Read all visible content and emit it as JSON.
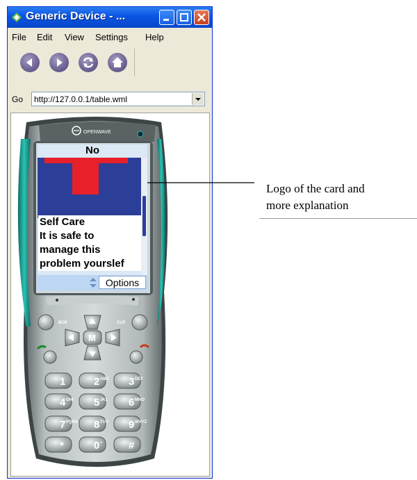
{
  "window": {
    "title": "Generic Device - ..."
  },
  "menu": [
    "File",
    "Edit",
    "View",
    "Settings",
    "Help"
  ],
  "toolbar": {
    "icons": [
      "back-icon",
      "forward-icon",
      "refresh-icon",
      "home-icon"
    ]
  },
  "address": {
    "label": "Go",
    "url": "http://127.0.0.1/table.wml"
  },
  "phone": {
    "brand": "OPENWAVE",
    "screen": {
      "title": "No",
      "lines": [
        "Self Care",
        "It is safe to",
        "manage this",
        "problem yourslef"
      ],
      "softkey": "Options"
    },
    "side_keys": {
      "back": "BCK",
      "clear": "CLR",
      "menu": "M"
    },
    "keypad": [
      {
        "digit": "1",
        "letters": ""
      },
      {
        "digit": "2",
        "letters": "ABC"
      },
      {
        "digit": "3",
        "letters": "DEF"
      },
      {
        "digit": "4",
        "letters": "GHI"
      },
      {
        "digit": "5",
        "letters": "JKL"
      },
      {
        "digit": "6",
        "letters": "MNO"
      },
      {
        "digit": "7",
        "letters": "PQRS"
      },
      {
        "digit": "8",
        "letters": "TUV"
      },
      {
        "digit": "9",
        "letters": "WXYZ"
      },
      {
        "digit": "*",
        "letters": ""
      },
      {
        "digit": "0",
        "letters": "+"
      },
      {
        "digit": "#",
        "letters": ""
      }
    ]
  },
  "annotation": {
    "lines": [
      "Logo of the card and",
      "more explanation"
    ]
  },
  "colors": {
    "logo_bg": "#2b3f98",
    "logo_t": "#e8202a",
    "phone_body": "#9aa3a4",
    "phone_trim": "#23a79b"
  }
}
